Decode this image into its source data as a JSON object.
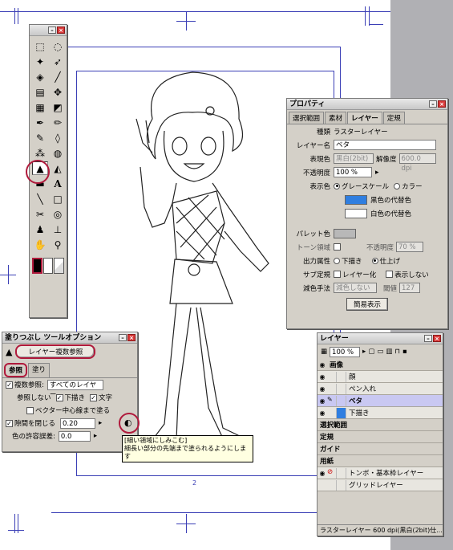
{
  "page": {
    "number": "2"
  },
  "toolbox": {
    "title": "",
    "tools": [
      "marquee-icon",
      "lasso-icon",
      "wand-icon",
      "move-icon",
      "bucket-select-icon",
      "eyedropper-icon",
      "ruler-icon",
      "move-layer-icon",
      "grid-icon",
      "3d-icon",
      "pen-icon",
      "pencil-icon",
      "brush-icon",
      "eraser-icon",
      "airbrush-icon",
      "blend-icon",
      "fill-icon",
      "gradient-fill-icon",
      "gradient-icon",
      "text-icon",
      "line-icon",
      "rect-icon",
      "object-icon",
      "tone-icon",
      "stamp-icon",
      "stamp2-icon",
      "hand-icon",
      "zoom-icon"
    ],
    "colors": [
      "#000000",
      "#ffffff",
      "#ffffff"
    ]
  },
  "property": {
    "title": "プロパティ",
    "tabs": [
      "選択範囲",
      "素材",
      "レイヤー",
      "定規"
    ],
    "kind_label": "種類",
    "kind_value": "ラスターレイヤー",
    "name_label": "レイヤー名",
    "name_value": "ベタ",
    "expr_label": "表現色",
    "expr_value": "黒白(2bit)",
    "res_label": "解像度",
    "res_value": "600.0 dpi",
    "opacity_label": "不透明度",
    "opacity_value": "100 %",
    "display_label": "表示色",
    "display_gray": "グレースケール",
    "display_color": "カラー",
    "black_replace": "黒色の代替色",
    "white_replace": "白色の代替色",
    "black_color": "#2f7ee0",
    "white_color": "#ffffff",
    "palette_label": "パレット色",
    "tone_label": "トーン領域",
    "tone_opacity_label": "不透明度",
    "tone_opacity_value": "70 %",
    "output_label": "出力属性",
    "output_draft": "下描き",
    "output_final": "仕上げ",
    "sub_label": "サブ定規",
    "sub_layer": "レイヤー化",
    "sub_hide": "表示しない",
    "reduce_label": "減色手法",
    "reduce_value": "減色しない",
    "threshold_label": "閾値",
    "threshold_value": "127",
    "simple_button": "簡易表示"
  },
  "toolopt": {
    "title": "塗りつぶし ツールオプション",
    "mode_button": "レイヤー複数参照",
    "tabs": [
      "参照",
      "塗り"
    ],
    "multi_ref_label": "複数参照:",
    "multi_ref_value": "すべてのレイヤー",
    "no_ref_label": "参照しない",
    "draft": "下描き",
    "text": "文字",
    "vector_center": "ベクター中心線まで塗る",
    "close_gap": "隙間を閉じる",
    "close_gap_value": "0.20 mm",
    "tolerance_label": "色の許容誤差:",
    "tolerance_value": "0.0"
  },
  "tooltip": {
    "line1": "[細い領域にしみこむ]",
    "line2": "細長い部分の先端まで塗られるようにします"
  },
  "layer": {
    "title": "レイヤー",
    "opacity": "100 %",
    "rows": [
      {
        "name": "画像",
        "type": "group"
      },
      {
        "name": "顔",
        "type": "layer"
      },
      {
        "name": "ペン入れ",
        "type": "layer"
      },
      {
        "name": "ベタ",
        "type": "selected"
      },
      {
        "name": "下描き",
        "type": "layer"
      },
      {
        "name": "選択範囲",
        "type": "group"
      },
      {
        "name": "定規",
        "type": "group"
      },
      {
        "name": "ガイド",
        "type": "group"
      },
      {
        "name": "用紙",
        "type": "group"
      },
      {
        "name": "トンボ・基本枠レイヤー",
        "type": "layer"
      },
      {
        "name": "グリッドレイヤー",
        "type": "layer"
      }
    ],
    "status": "ラスターレイヤー 600 dpi(黒白(2bit)仕..."
  }
}
